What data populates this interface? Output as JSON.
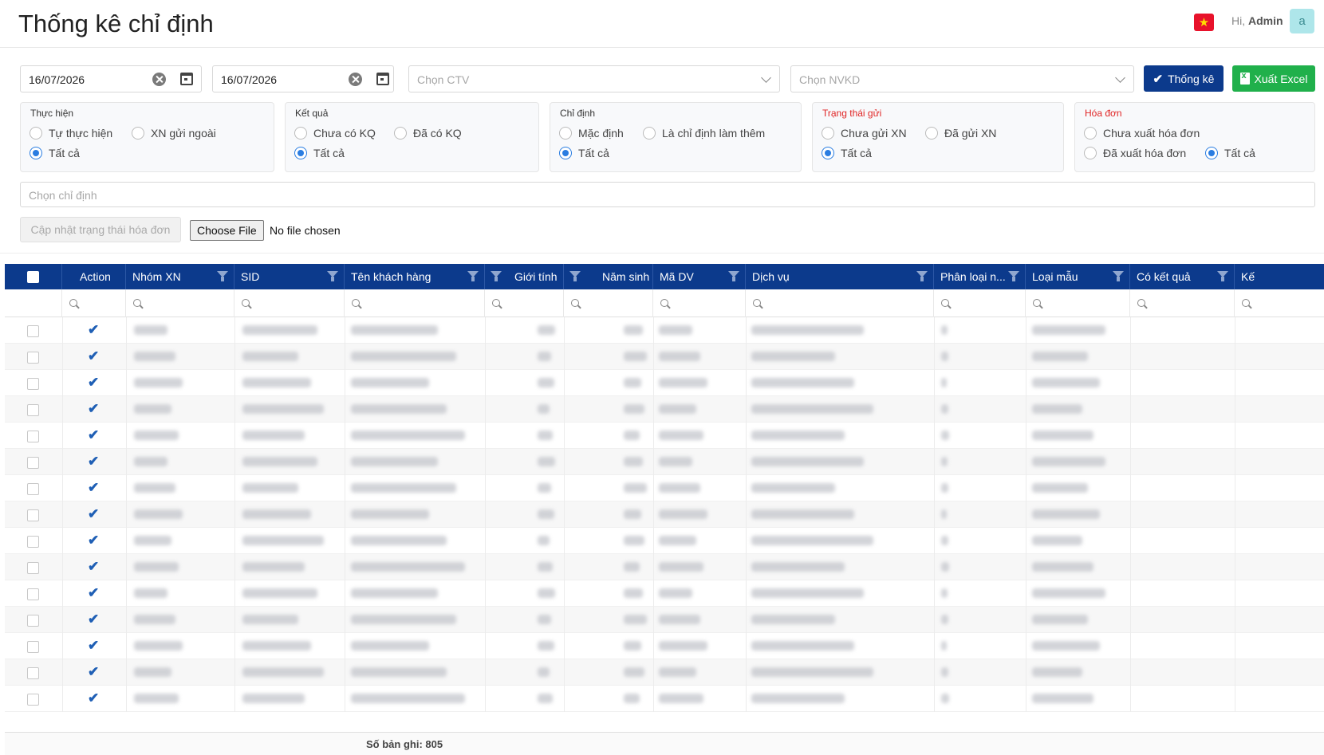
{
  "header": {
    "title": "Thống kê chỉ định",
    "flag_icon": "vietnam-flag-icon",
    "greeting_prefix": "Hi,",
    "user_name": "Admin",
    "avatar_letter": "a"
  },
  "filters": {
    "from_date": "16/07/2026",
    "to_date": "16/07/2026",
    "ctv_placeholder": "Chọn CTV",
    "nvkd_placeholder": "Chọn NVKD",
    "stats_button": "Thống kê",
    "export_button": "Xuất Excel",
    "chidinh_placeholder": "Chọn chỉ định",
    "update_invoice_button": "Cập nhật trạng thái hóa đơn",
    "choose_file_button": "Choose File",
    "no_file_text": "No file chosen"
  },
  "groups": {
    "thuc_hien": {
      "title": "Thực hiện",
      "opt1": "Tự thực hiện",
      "opt2": "XN gửi ngoài",
      "opt3": "Tất cả",
      "selected": "Tất cả"
    },
    "ket_qua": {
      "title": "Kết quả",
      "opt1": "Chưa có KQ",
      "opt2": "Đã có KQ",
      "opt3": "Tất cả",
      "selected": "Tất cả"
    },
    "chi_dinh": {
      "title": "Chỉ định",
      "opt1": "Mặc định",
      "opt2": "Là chỉ định làm thêm",
      "opt3": "Tất cả",
      "selected": "Tất cả"
    },
    "trang_thai_gui": {
      "title": "Trạng thái gửi",
      "opt1": "Chưa gửi XN",
      "opt2": "Đã gửi XN",
      "opt3": "Tất cả",
      "selected": "Tất cả"
    },
    "hoa_don": {
      "title": "Hóa đơn",
      "opt1": "Chưa xuất hóa đơn",
      "opt2": "Đã xuất hóa đơn",
      "opt3": "Tất cả",
      "selected": "Tất cả"
    }
  },
  "table": {
    "columns": {
      "action": "Action",
      "nhom_xn": "Nhóm XN",
      "sid": "SID",
      "ten_kh": "Tên khách hàng",
      "gioi_tinh": "Giới tính",
      "nam_sinh": "Năm sinh",
      "ma_dv": "Mã DV",
      "dich_vu": "Dịch vụ",
      "phan_loai": "Phân loại n...",
      "loai_mau": "Loại mẫu",
      "co_ket_qua": "Có kết quả",
      "ket": "Kế"
    },
    "action_icon": "check-icon",
    "visible_row_count": 15,
    "row_values_visible": false
  },
  "footer": {
    "record_count": "Số bản ghi: 805"
  },
  "colors": {
    "header_bg": "#0c3a8c",
    "primary_button": "#0c3a8c",
    "export_button": "#20b04b",
    "radio_selected": "#2a7de1",
    "group_title_red": "#e02424"
  }
}
